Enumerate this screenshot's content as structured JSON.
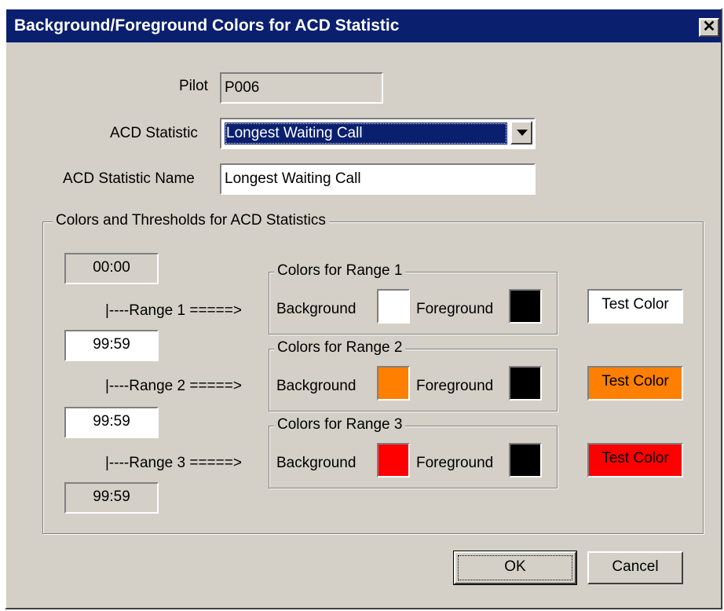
{
  "window": {
    "title": "Background/Foreground Colors for ACD Statistic",
    "close_glyph": "✕"
  },
  "form": {
    "pilot_label": "Pilot",
    "pilot_value": "P006",
    "statistic_label": "ACD Statistic",
    "statistic_value": "Longest Waiting Call",
    "statistic_name_label": "ACD Statistic Name",
    "statistic_name_value": "Longest Waiting Call"
  },
  "thresholds": {
    "group_title": "Colors and Thresholds for ACD Statistics",
    "times": [
      "00:00",
      "99:59",
      "99:59",
      "99:59"
    ],
    "range_labels": [
      "|----Range 1 =====>",
      "|----Range 2 =====>",
      "|----Range 3 =====>"
    ],
    "ranges": [
      {
        "title": "Colors for Range 1",
        "background_label": "Background",
        "foreground_label": "Foreground",
        "background_color": "#ffffff",
        "foreground_color": "#000000",
        "test_label": "Test Color"
      },
      {
        "title": "Colors for Range 2",
        "background_label": "Background",
        "foreground_label": "Foreground",
        "background_color": "#ff8000",
        "foreground_color": "#000000",
        "test_label": "Test Color"
      },
      {
        "title": "Colors for Range 3",
        "background_label": "Background",
        "foreground_label": "Foreground",
        "background_color": "#ff0000",
        "foreground_color": "#000000",
        "test_label": "Test Color"
      }
    ]
  },
  "buttons": {
    "ok": "OK",
    "cancel": "Cancel"
  },
  "colors": {
    "dialog_bg": "#d4d0c8",
    "titlebar_bg": "#0a1f6e",
    "selection_bg": "#0a1f6e"
  }
}
